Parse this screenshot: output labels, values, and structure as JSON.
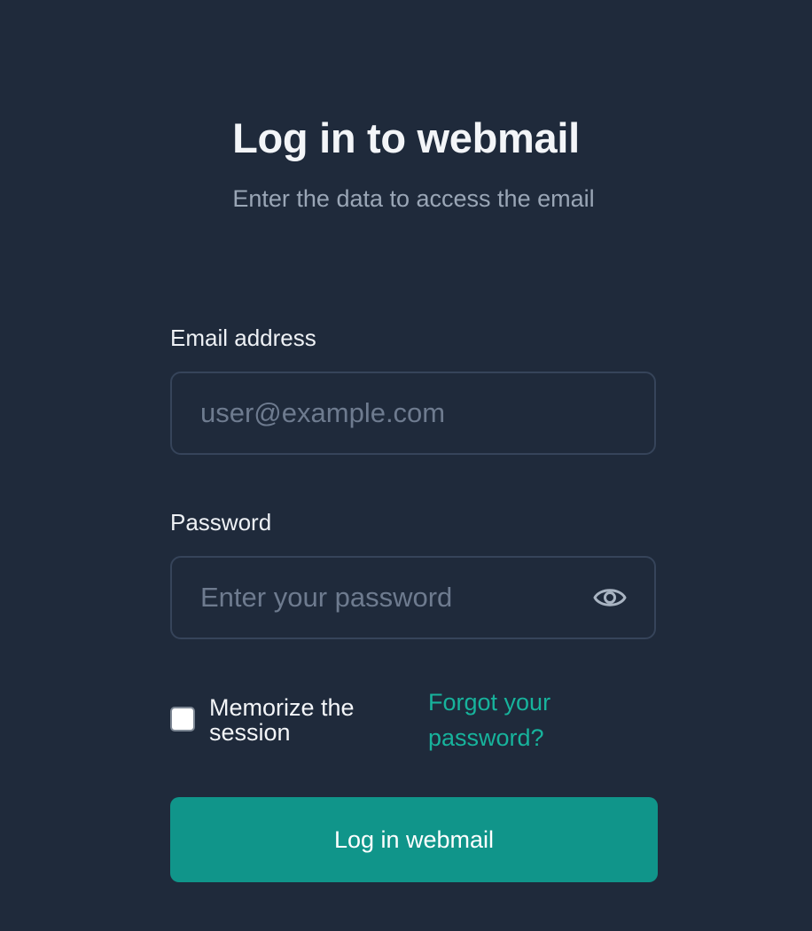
{
  "header": {
    "title": "Log in to webmail",
    "subtitle": "Enter the data to access the email"
  },
  "form": {
    "email": {
      "label": "Email address",
      "value": "",
      "placeholder": "user@example.com"
    },
    "password": {
      "label": "Password",
      "value": "",
      "placeholder": "Enter your password",
      "toggle_icon": "eye-icon"
    },
    "remember": {
      "label": "Memorize the session",
      "checked": false
    },
    "forgot_link": "Forgot your password?",
    "submit_label": "Log in webmail"
  },
  "colors": {
    "background": "#1f2a3b",
    "accent": "#10958a",
    "link": "#17b39c",
    "field_border": "#36445a",
    "placeholder": "#6e7b8f"
  }
}
